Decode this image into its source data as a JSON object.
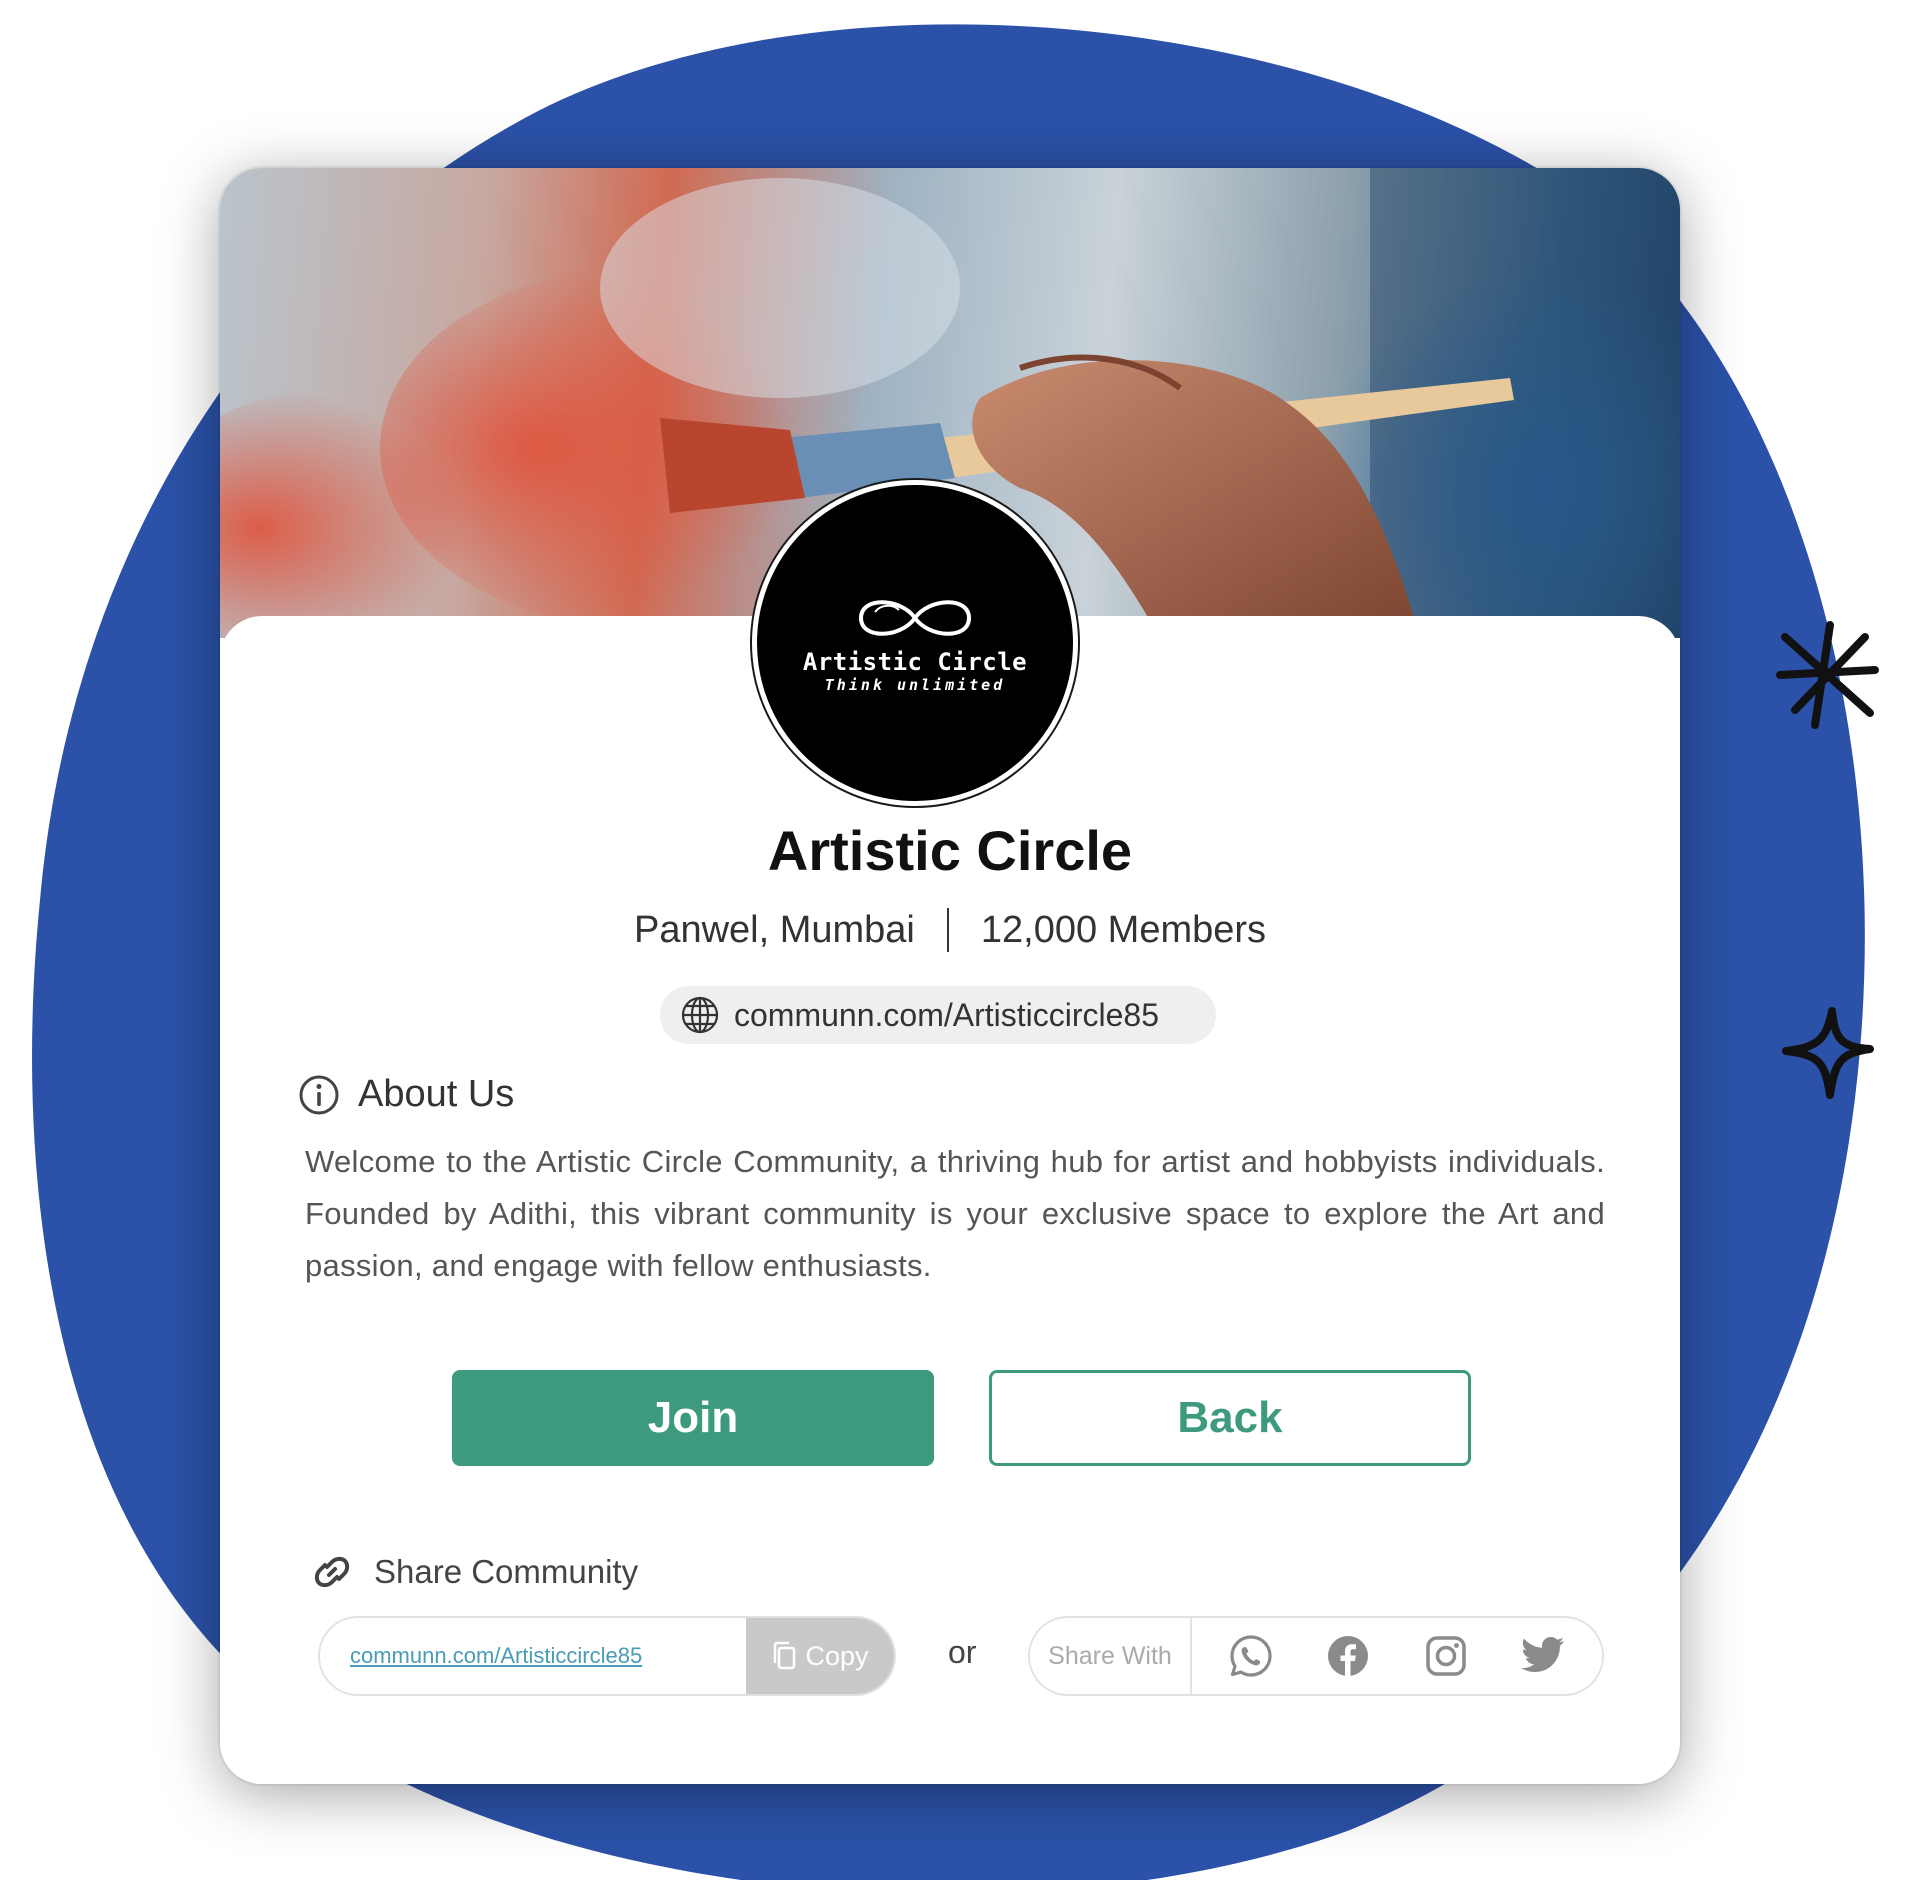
{
  "community": {
    "name": "Artistic Circle",
    "location": "Panwel, Mumbai",
    "members": "12,000 Members",
    "url": "communn.com/Artisticcircle85"
  },
  "logo": {
    "name": "Artistic Circle",
    "tagline": "Think unlimited"
  },
  "about": {
    "heading": "About Us",
    "text": "Welcome to the Artistic Circle Community, a thriving hub for artist and hobbyists individuals. Founded by Adithi, this vibrant community is your exclusive space to explore the Art and passion, and engage with fellow enthusiasts."
  },
  "actions": {
    "join_label": "Join",
    "back_label": "Back"
  },
  "share": {
    "heading": "Share Community",
    "link": "communn.com/Artisticcircle85",
    "copy_label": "Copy",
    "or_label": "or",
    "share_with_label": "Share With",
    "channels": [
      "whatsapp-icon",
      "facebook-icon",
      "instagram-icon",
      "twitter-icon"
    ]
  },
  "colors": {
    "accent": "#3d9a7e",
    "background_blob": "#2b52a8",
    "link": "#4a9bb8"
  }
}
